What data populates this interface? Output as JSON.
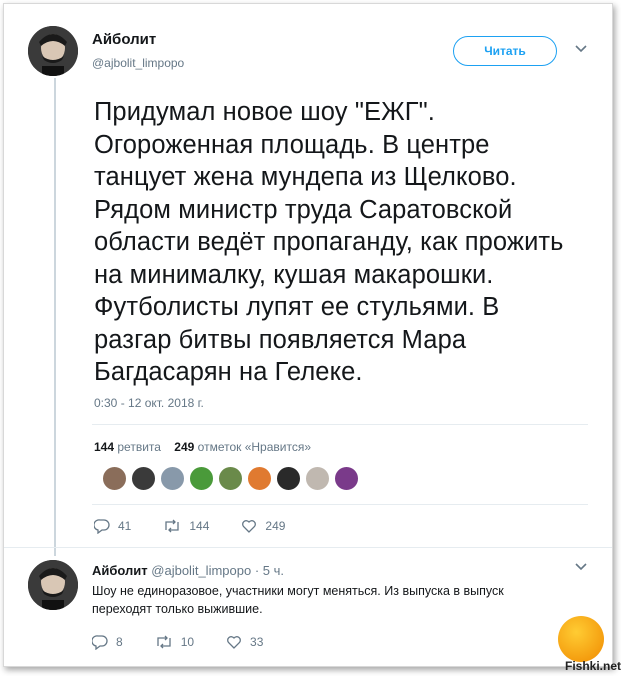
{
  "tweet": {
    "author_name": "Айболит",
    "author_handle": "@ajbolit_limpopo",
    "follow_label": "Читать",
    "text": "Придумал новое шоу \"ЕЖГ\". Огороженная площадь. В центре танцует жена мундепа из Щелково. Рядом министр труда Саратовской области ведёт пропаганду, как прожить на минималку, кушая макарошки. Футболисты лупят ее стульями. В разгар битвы появляется Мара Багдасарян на Гелеке.",
    "timestamp": "0:30 - 12 окт. 2018 г.",
    "retweets_count": "144",
    "retweets_label": "ретвита",
    "likes_count": "249",
    "likes_label": "отметок «Нравится»",
    "actions": {
      "replies": "41",
      "retweets": "144",
      "likes": "249"
    }
  },
  "likers": [
    {
      "color": "#8a6d5a"
    },
    {
      "color": "#3a3a3a"
    },
    {
      "color": "#8899aa"
    },
    {
      "color": "#4a9a3a"
    },
    {
      "color": "#6a8a4a"
    },
    {
      "color": "#e07a30"
    },
    {
      "color": "#2a2a2a"
    },
    {
      "color": "#c0b8b0"
    },
    {
      "color": "#7a3a8a"
    }
  ],
  "reply": {
    "author_name": "Айболит",
    "author_handle": "@ajbolit_limpopo",
    "time": "· 5 ч.",
    "text": "Шоу не единоразовое, участники могут меняться. Из выпуска в выпуск переходят только выжившие.",
    "actions": {
      "replies": "8",
      "retweets": "10",
      "likes": "33"
    }
  },
  "watermark": {
    "site": "Fishki.net"
  },
  "colors": {
    "accent": "#1da1f2",
    "muted": "#657786",
    "text": "#14171a"
  }
}
